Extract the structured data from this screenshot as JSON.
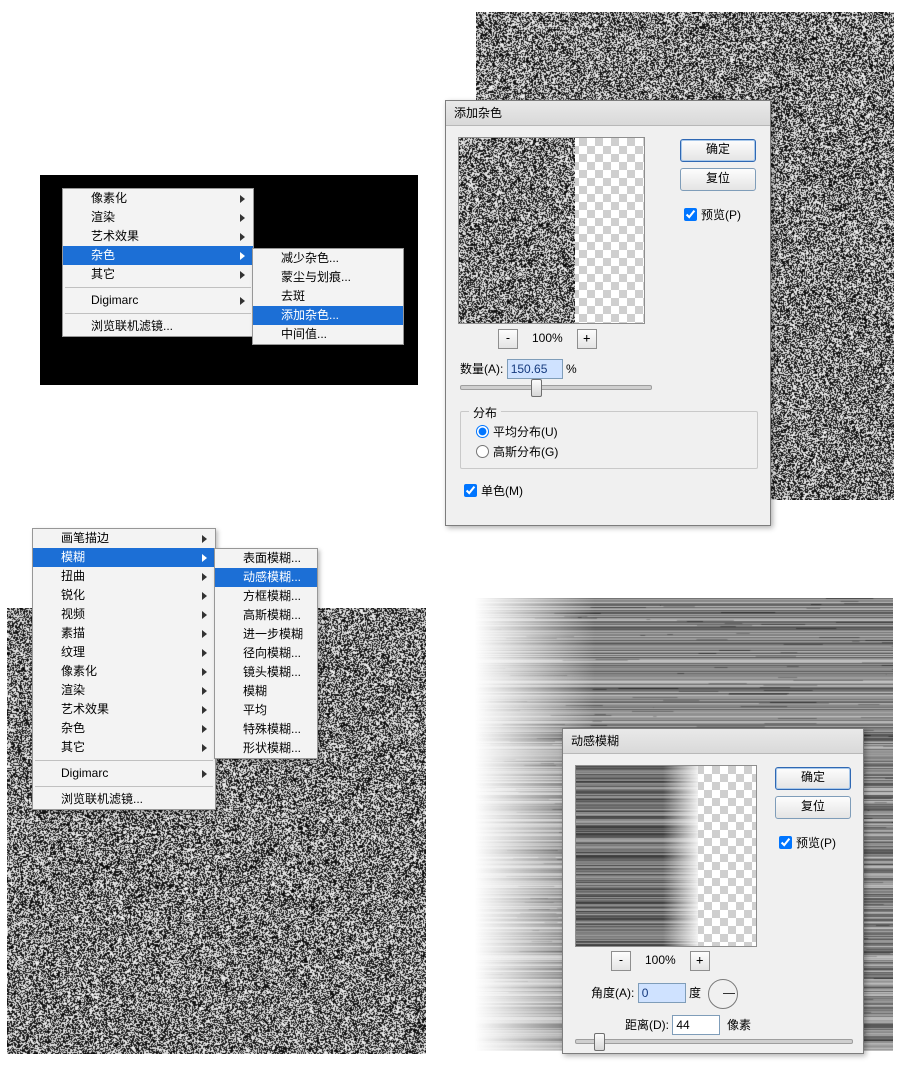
{
  "menu1": {
    "main": [
      {
        "label": "像素化",
        "sub": true
      },
      {
        "label": "渲染",
        "sub": true
      },
      {
        "label": "艺术效果",
        "sub": true
      },
      {
        "label": "杂色",
        "sub": true,
        "hi": true
      },
      {
        "label": "其它",
        "sub": true
      }
    ],
    "main_sep_after": 4,
    "main_after": [
      {
        "label": "Digimarc",
        "sub": true
      }
    ],
    "main_browse": "浏览联机滤镜...",
    "sub": [
      "减少杂色...",
      "蒙尘与划痕...",
      "去斑",
      "添加杂色...",
      "中间值..."
    ],
    "sub_hi_index": 3
  },
  "addnoise": {
    "title": "添加杂色",
    "ok": "确定",
    "reset": "复位",
    "preview_label": "预览(P)",
    "preview_checked": true,
    "zoom": "100%",
    "amount_label": "数量(A):",
    "amount_value": "150.65",
    "amount_unit": "%",
    "dist_legend": "分布",
    "dist_uniform": "平均分布(U)",
    "dist_gauss": "高斯分布(G)",
    "dist_selected": "uniform",
    "mono_label": "单色(M)",
    "mono_checked": true
  },
  "menu2": {
    "main": [
      {
        "label": "画笔描边",
        "sub": true
      },
      {
        "label": "模糊",
        "sub": true,
        "hi": true
      },
      {
        "label": "扭曲",
        "sub": true
      },
      {
        "label": "锐化",
        "sub": true
      },
      {
        "label": "视频",
        "sub": true
      },
      {
        "label": "素描",
        "sub": true
      },
      {
        "label": "纹理",
        "sub": true
      },
      {
        "label": "像素化",
        "sub": true
      },
      {
        "label": "渲染",
        "sub": true
      },
      {
        "label": "艺术效果",
        "sub": true
      },
      {
        "label": "杂色",
        "sub": true
      },
      {
        "label": "其它",
        "sub": true
      }
    ],
    "main_after": [
      {
        "label": "Digimarc",
        "sub": true
      }
    ],
    "main_browse": "浏览联机滤镜...",
    "sub": [
      "表面模糊...",
      "动感模糊...",
      "方框模糊...",
      "高斯模糊...",
      "进一步模糊",
      "径向模糊...",
      "镜头模糊...",
      "模糊",
      "平均",
      "特殊模糊...",
      "形状模糊..."
    ],
    "sub_hi_index": 1
  },
  "motionblur": {
    "title": "动感模糊",
    "ok": "确定",
    "reset": "复位",
    "preview_label": "预览(P)",
    "preview_checked": true,
    "zoom": "100%",
    "angle_label": "角度(A):",
    "angle_value": "0",
    "angle_unit": "度",
    "distance_label": "距离(D):",
    "distance_value": "44",
    "distance_unit": "像素"
  }
}
